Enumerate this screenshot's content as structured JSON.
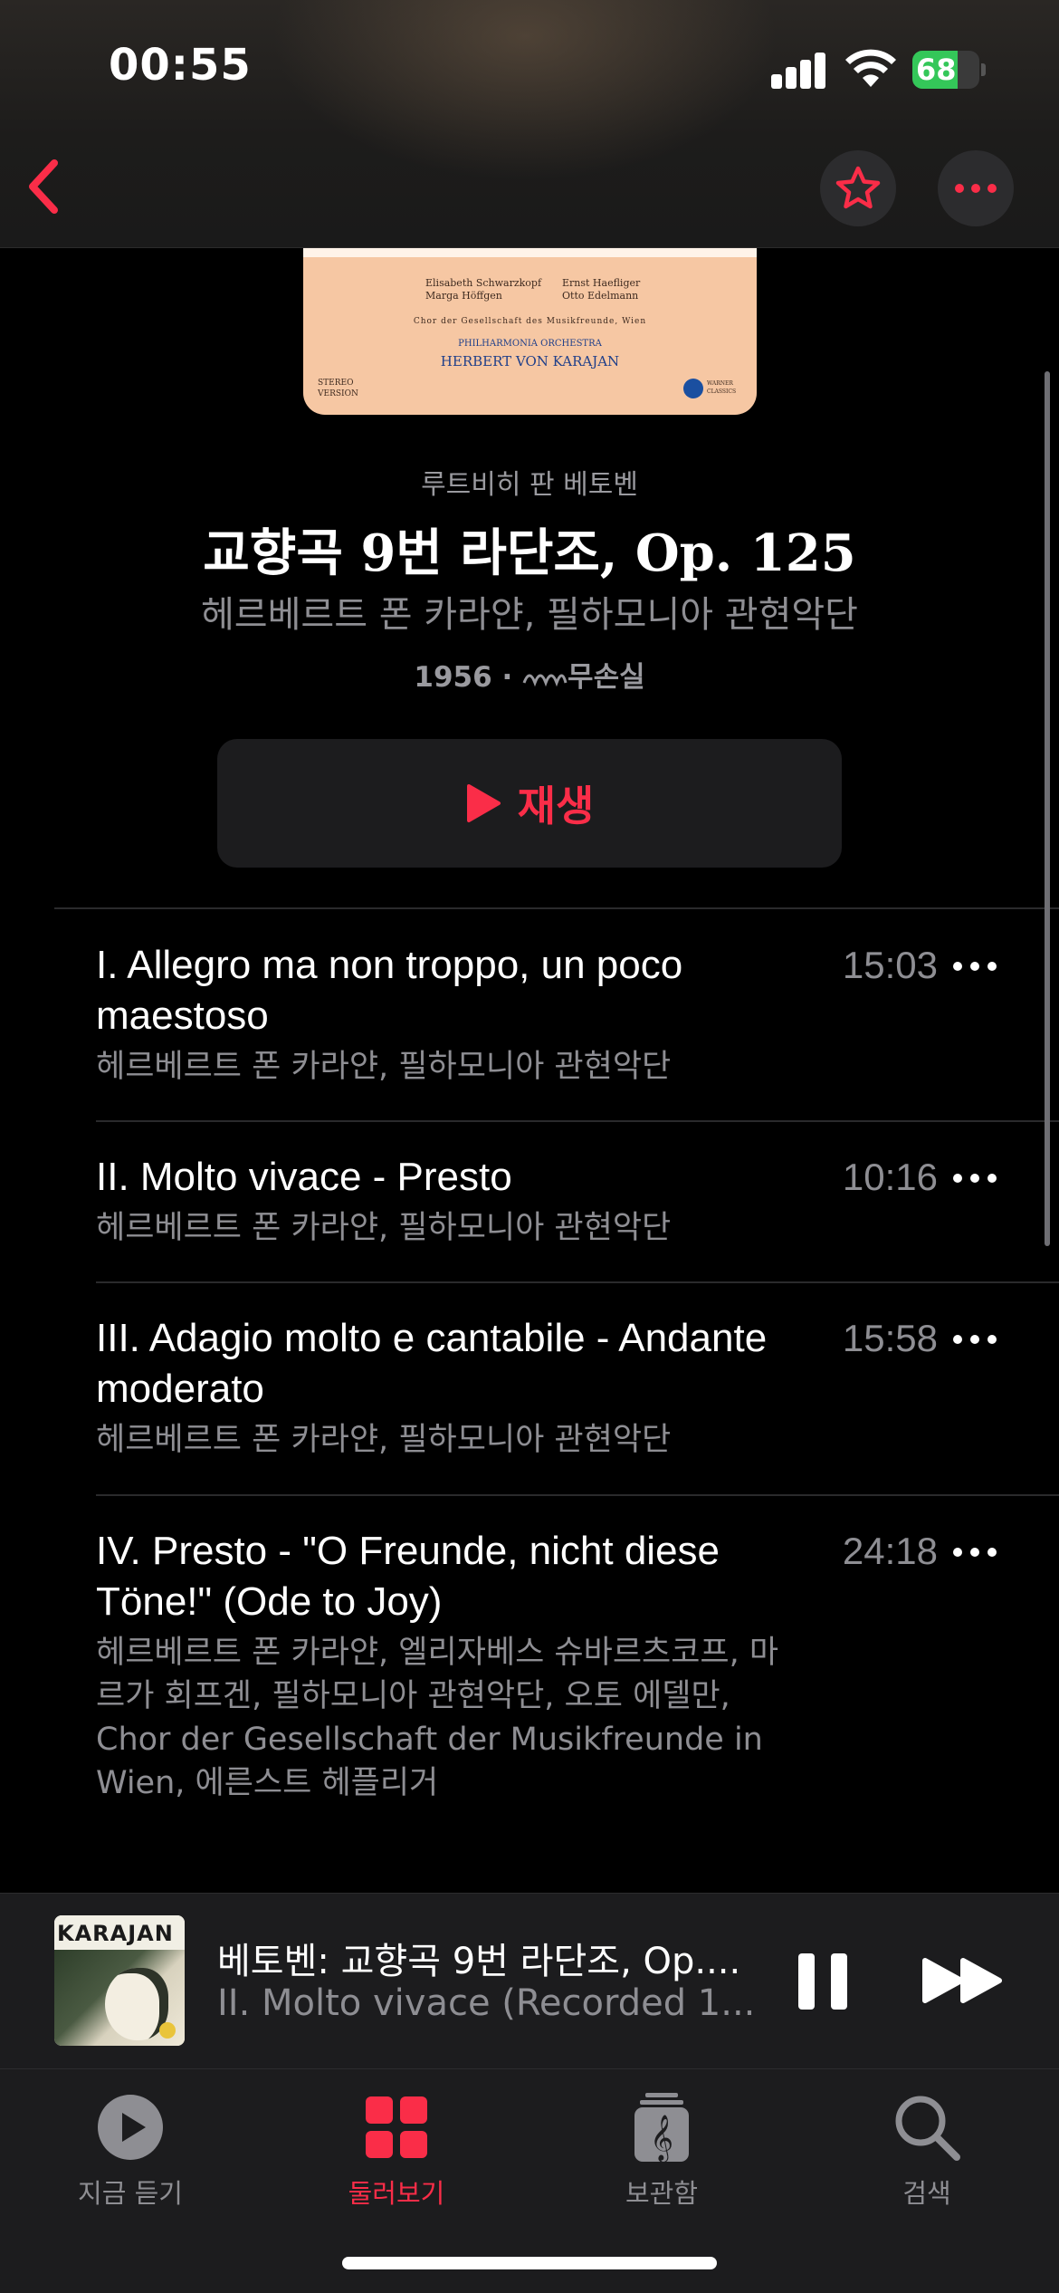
{
  "status_bar": {
    "time": "00:55",
    "battery": "68",
    "battery_level": 0.68
  },
  "header": {
    "back_icon": "chevron-left-icon",
    "favorite_icon": "star-icon",
    "more_icon": "ellipsis-icon",
    "accent": "#fa2d48"
  },
  "album_art": {
    "soloists_left": [
      "Elisabeth Schwarzkopf",
      "Marga Höffgen"
    ],
    "soloists_right": [
      "Ernst Haefliger",
      "Otto Edelmann"
    ],
    "choir": "Chor der Gesellschaft des Musikfreunde, Wien",
    "orchestra": "PHILHARMONIA ORCHESTRA",
    "conductor": "HERBERT VON KARAJAN",
    "stereo_1": "STEREO",
    "stereo_2": "VERSION",
    "label_1": "WARNER",
    "label_2": "CLASSICS"
  },
  "album": {
    "composer": "루트비히 판 베토벤",
    "title": "교향곡 9번 라단조, Op. 125",
    "artist": "헤르베르트 폰 카라얀, 필하모니아 관현악단",
    "year": "1956",
    "separator": "·",
    "quality": "무손실",
    "play_label": "재생"
  },
  "tracks": [
    {
      "name": "I. Allegro ma non troppo, un poco maestoso",
      "artists": "헤르베르트 폰 카라얀, 필하모니아 관현악단",
      "duration": "15:03"
    },
    {
      "name": "II. Molto vivace - Presto",
      "artists": "헤르베르트 폰 카라얀, 필하모니아 관현악단",
      "duration": "10:16"
    },
    {
      "name": "III. Adagio molto e cantabile - Andante moderato",
      "artists": "헤르베르트 폰 카라얀, 필하모니아 관현악단",
      "duration": "15:58"
    },
    {
      "name": "IV. Presto - \"O Freunde, nicht diese Töne!\" (Ode to Joy)",
      "artists": "헤르베르트 폰 카라얀, 엘리자베스 슈바르츠코프, 마르가 회프겐, 필하모니아 관현악단, 오토 에델만, Chor der Gesellschaft der Musikfreunde in Wien, 에른스트 헤플리거",
      "duration": "24:18"
    }
  ],
  "mini_player": {
    "art_text": "KARAJAN",
    "title": "베토벤: 교향곡 9번 라단조, Op....",
    "subtitle": "II. Molto vivace (Recorded 1...",
    "pause_icon": "pause-icon",
    "forward_icon": "fast-forward-icon"
  },
  "tabs": [
    {
      "label": "지금 듣기",
      "icon": "play-circle-icon"
    },
    {
      "label": "둘러보기",
      "icon": "grid-icon",
      "active": true
    },
    {
      "label": "보관함",
      "icon": "library-icon"
    },
    {
      "label": "검색",
      "icon": "search-icon"
    }
  ]
}
